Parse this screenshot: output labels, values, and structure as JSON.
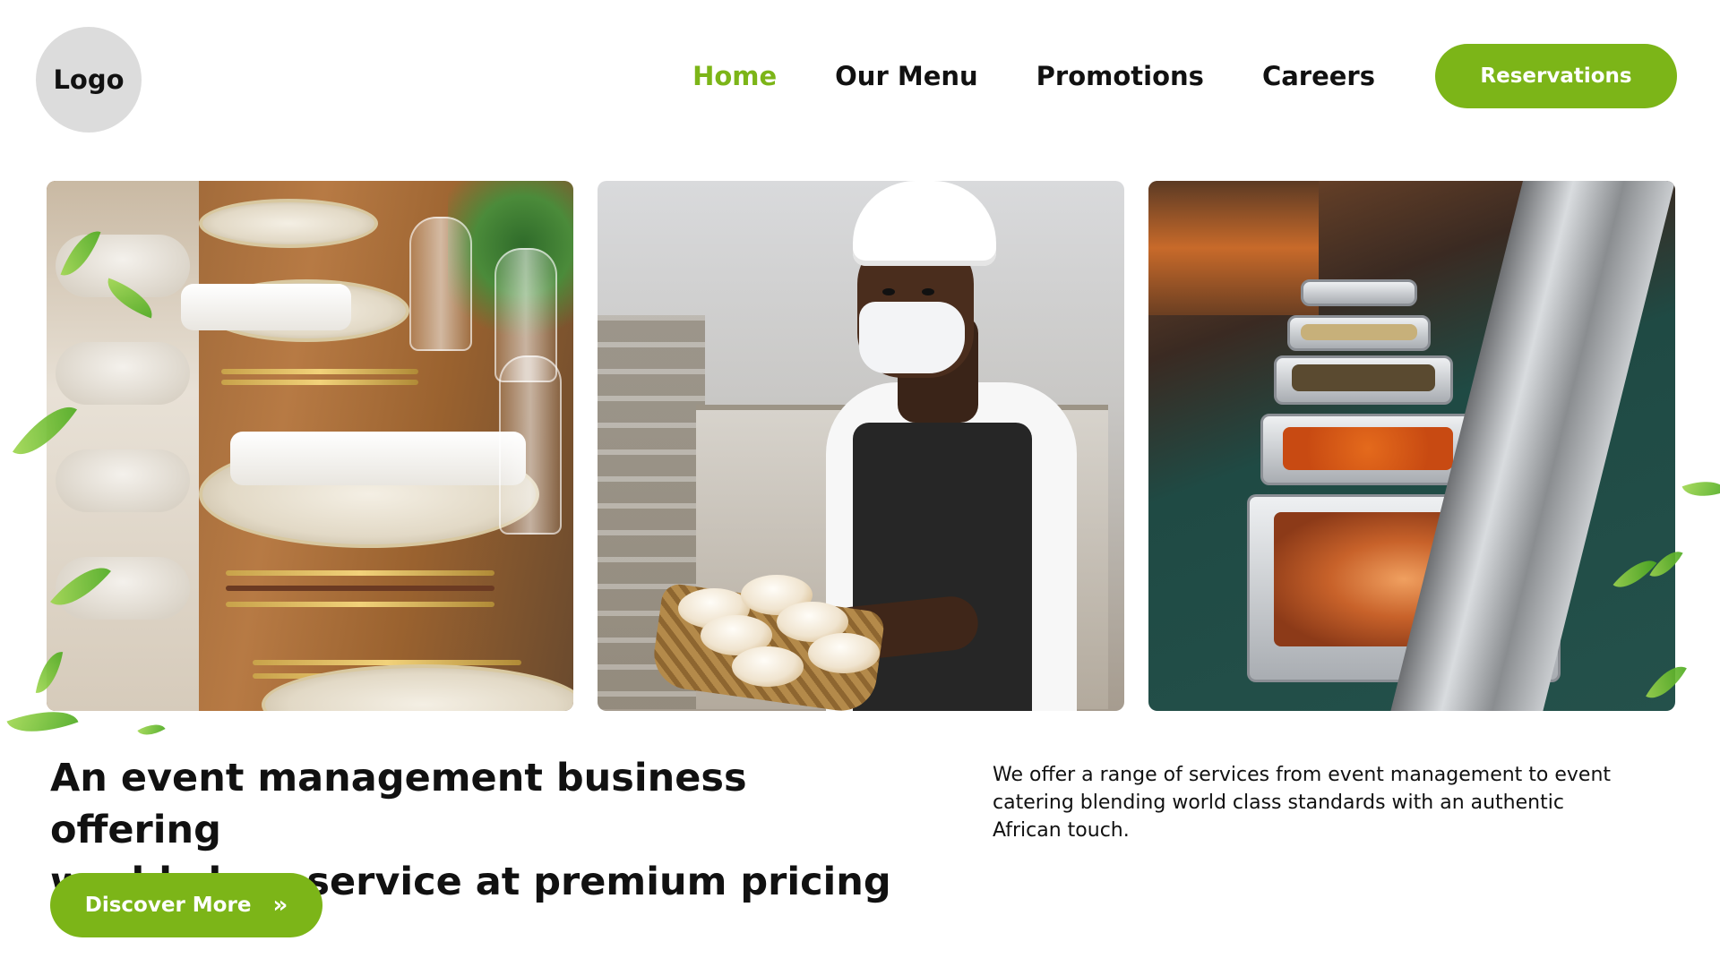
{
  "header": {
    "logo_text": "Logo",
    "nav": [
      {
        "label": "Home",
        "active": true
      },
      {
        "label": "Our Menu",
        "active": false
      },
      {
        "label": "Promotions",
        "active": false
      },
      {
        "label": "Careers",
        "active": false
      }
    ],
    "cta_label": "Reservations"
  },
  "gallery": [
    {
      "subject": "banquet-table-setting"
    },
    {
      "subject": "chef-with-bread-basket"
    },
    {
      "subject": "buffet-chafing-dishes"
    }
  ],
  "hero": {
    "headline_line1": "An event management business offering",
    "headline_line2": "world class service at premium pricing",
    "description": "We offer a range of services from event management to event catering blending world class standards with an authentic African touch.",
    "cta_label": "Discover More",
    "cta_icon": "double-chevron-right-icon"
  },
  "colors": {
    "accent": "#7cb518",
    "text": "#111111",
    "logo_bg": "#dcdcdc",
    "background": "#ffffff"
  }
}
